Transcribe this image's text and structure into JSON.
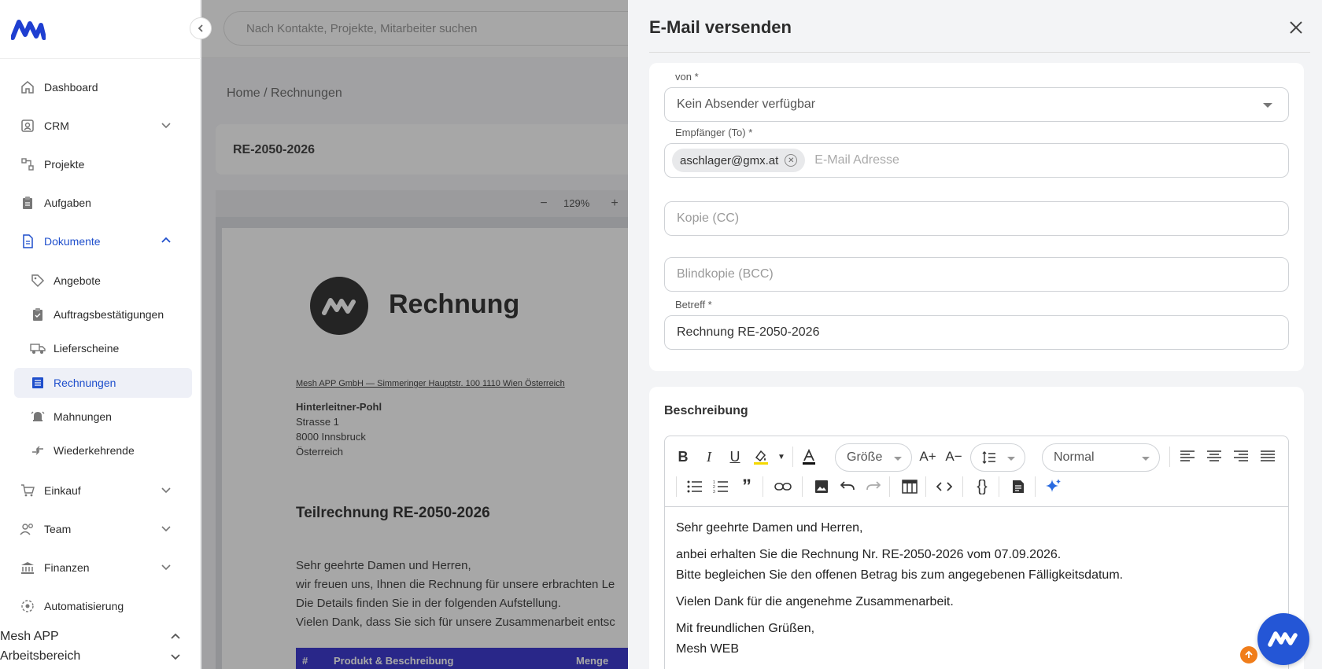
{
  "search": {
    "placeholder": "Nach Kontakte, Projekte, Mitarbeiter suchen"
  },
  "sidebar": {
    "items": [
      {
        "label": "Dashboard"
      },
      {
        "label": "CRM"
      },
      {
        "label": "Projekte"
      },
      {
        "label": "Aufgaben"
      },
      {
        "label": "Dokumente"
      },
      {
        "label": "Einkauf"
      },
      {
        "label": "Team"
      },
      {
        "label": "Finanzen"
      },
      {
        "label": "Automatisierung"
      }
    ],
    "subitems": [
      {
        "label": "Angebote"
      },
      {
        "label": "Auftragsbestätigungen"
      },
      {
        "label": "Lieferscheine"
      },
      {
        "label": "Rechnungen"
      },
      {
        "label": "Mahnungen"
      },
      {
        "label": "Wiederkehrende"
      }
    ],
    "workspace": {
      "app": "Mesh APP",
      "area": "Arbeitsbereich"
    }
  },
  "main": {
    "breadcrumb": "Home / Rechnungen",
    "doc_id": "RE-2050-2026",
    "zoom": "129%"
  },
  "pdf": {
    "title": "Rechnung",
    "sender_line": "Mesh APP GmbH — Simmeringer Hauptstr. 100 1110 Wien Österreich",
    "recipient": {
      "name": "Hinterleitner-Pohl",
      "street": "Strasse 1",
      "city": "8000 Innsbruck",
      "country": "Österreich"
    },
    "heading": "Teilrechnung RE-2050-2026",
    "body": [
      "Sehr geehrte Damen und Herren,",
      "wir freuen uns, Ihnen die Rechnung für unsere erbrachten Le",
      "Die Details finden Sie in der folgenden Aufstellung.",
      "Vielen Dank, dass Sie sich für unsere Zusammenarbeit entsc"
    ],
    "table_head": {
      "col1": "#",
      "col2": "Produkt & Beschreibung",
      "col3": "Menge"
    }
  },
  "email": {
    "title": "E-Mail versenden",
    "from": {
      "label": "von *",
      "value": "Kein Absender verfügbar"
    },
    "to": {
      "label": "Empfänger (To) *",
      "chip": "aschlager@gmx.at",
      "placeholder": "E-Mail Adresse"
    },
    "cc": {
      "placeholder": "Kopie (CC)"
    },
    "bcc": {
      "placeholder": "Blindkopie (BCC)"
    },
    "subject": {
      "label": "Betreff *",
      "value": "Rechnung RE-2050-2026"
    },
    "description": {
      "title": "Beschreibung",
      "size_label": "Größe",
      "style_label": "Normal",
      "body": [
        "Sehr geehrte Damen und Herren,",
        "anbei erhalten Sie die Rechnung Nr. RE-2050-2026 vom 07.09.2026.",
        "Bitte begleichen Sie den offenen Betrag bis zum angegebenen Fälligkeitsdatum.",
        "Vielen Dank für die angenehme Zusammenarbeit.",
        "Mit freundlichen Grüßen,",
        "Mesh WEB"
      ]
    }
  },
  "colors": {
    "accent": "#1f4fcc",
    "fab": "#2456d6",
    "badge": "#f07d1a"
  }
}
